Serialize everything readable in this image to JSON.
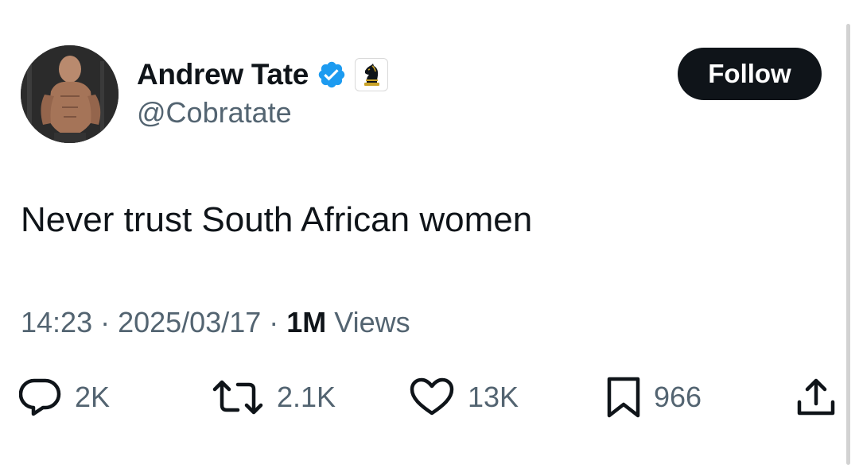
{
  "author": {
    "display_name": "Andrew Tate",
    "handle": "@Cobratate",
    "verified_icon": "verified-badge-icon",
    "affiliate_icon": "chess-knight-icon"
  },
  "follow_label": "Follow",
  "tweet": {
    "text": "Never trust South African women",
    "time": "14:23",
    "separator": " · ",
    "date": "2025/03/17",
    "views_count": "1M",
    "views_label": " Views"
  },
  "actions": {
    "replies": "2K",
    "reposts": "2.1K",
    "likes": "13K",
    "bookmarks": "966"
  },
  "colors": {
    "verified_blue": "#1d9bf0",
    "text_primary": "#0f1419",
    "text_secondary": "#536471"
  }
}
